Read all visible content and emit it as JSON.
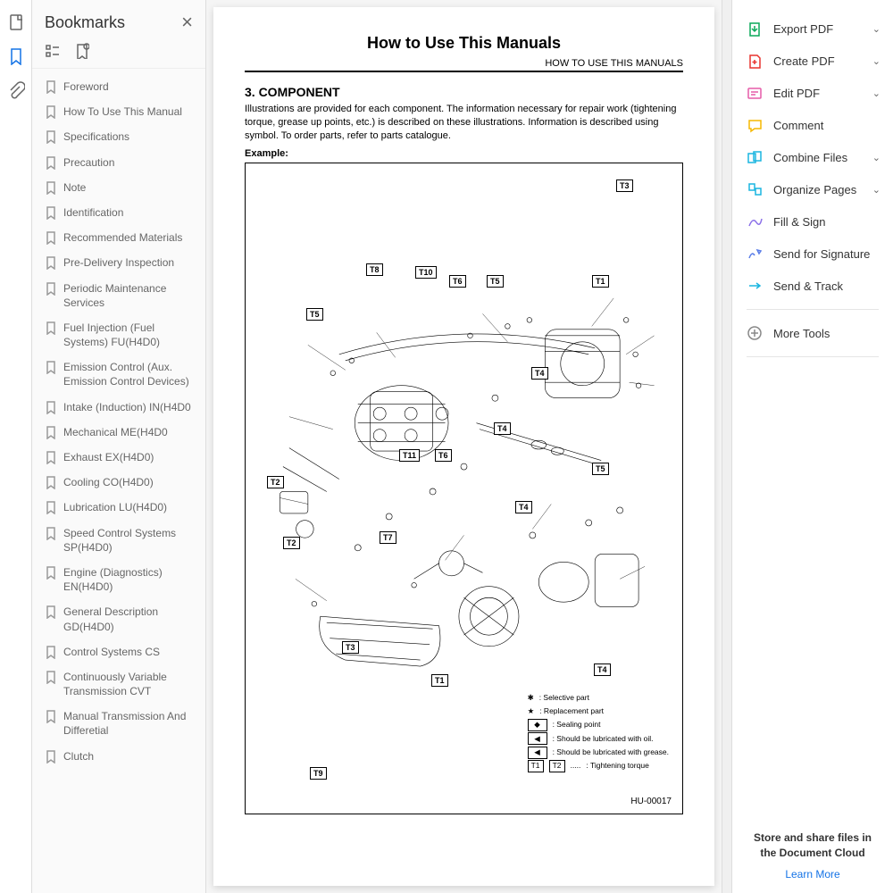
{
  "panel": {
    "title": "Bookmarks"
  },
  "bookmarks": [
    "Foreword",
    "How To Use This Manual",
    "Specifications",
    "Precaution",
    "Note",
    "Identification",
    "Recommended Materials",
    "Pre-Delivery Inspection",
    "Periodic Maintenance Services",
    "Fuel Injection (Fuel Systems) FU(H4D0)",
    "Emission Control (Aux. Emission Control Devices)",
    "Intake (Induction) IN(H4D0",
    "Mechanical ME(H4D0",
    "Exhaust EX(H4D0)",
    "Cooling CO(H4D0)",
    "Lubrication LU(H4D0)",
    "Speed Control Systems SP(H4D0)",
    "Engine (Diagnostics) EN(H4D0)",
    "General Description GD(H4D0)",
    "Control Systems CS",
    "Continuously Variable Transmission CVT",
    "Manual Transmission And Differetial",
    "Clutch"
  ],
  "page": {
    "title": "How to Use This Manuals",
    "header_right": "HOW TO USE THIS MANUALS",
    "section": "3.  COMPONENT",
    "body": "Illustrations are provided for each component. The information necessary for repair work (tightening torque, grease up points, etc.) is described on these illustrations. Information is described using symbol. To order parts, refer to parts catalogue.",
    "example": "Example:",
    "diagram_id": "HU-00017",
    "legend": {
      "selective": ": Selective part",
      "replacement": ": Replacement part",
      "sealing": ": Sealing point",
      "oil": ": Should be lubricated with oil.",
      "grease": ": Should be lubricated with grease.",
      "torque": ": Tightening torque"
    },
    "callouts": [
      "T1",
      "T2",
      "T3",
      "T4",
      "T5",
      "T6",
      "T7",
      "T8",
      "T9",
      "T10",
      "T11"
    ]
  },
  "tools": [
    {
      "label": "Export PDF",
      "color": "#0aa85a",
      "ch": true
    },
    {
      "label": "Create PDF",
      "color": "#e8342e",
      "ch": true
    },
    {
      "label": "Edit PDF",
      "color": "#e55ba8",
      "ch": true
    },
    {
      "label": "Comment",
      "color": "#f5b800",
      "ch": false
    },
    {
      "label": "Combine Files",
      "color": "#1ab5e0",
      "ch": true
    },
    {
      "label": "Organize Pages",
      "color": "#1ab5e0",
      "ch": true
    },
    {
      "label": "Fill & Sign",
      "color": "#8a6fe8",
      "ch": false
    },
    {
      "label": "Send for Signature",
      "color": "#5a7de8",
      "ch": false
    },
    {
      "label": "Send & Track",
      "color": "#1ab5e0",
      "ch": false
    },
    {
      "label": "More Tools",
      "color": "#888",
      "ch": false
    }
  ],
  "cloud": {
    "text": "Store and share files in the Document Cloud",
    "link": "Learn More"
  }
}
